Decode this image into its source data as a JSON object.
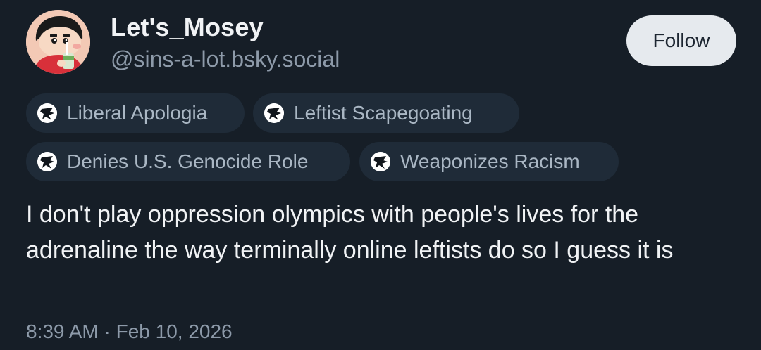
{
  "author": {
    "display_name": "Let's_Mosey",
    "handle": "@sins-a-lot.bsky.social",
    "avatar_icon": "cartoon-boy-avatar-icon"
  },
  "follow": {
    "label": "Follow"
  },
  "labels": [
    {
      "icon": "moderation-label-icon",
      "text": "Liberal Apologia"
    },
    {
      "icon": "moderation-label-icon",
      "text": "Leftist Scapegoating"
    },
    {
      "icon": "moderation-label-icon",
      "text": "Denies U.S. Genocide Role"
    },
    {
      "icon": "moderation-label-icon",
      "text": "Weaponizes Racism"
    }
  ],
  "post": {
    "text": "I don't play oppression olympics with people's lives for the adrenaline the way terminally online leftists do so I guess it is",
    "timestamp": "8:39 AM · Feb 10, 2026"
  },
  "colors": {
    "background": "#161e27",
    "pill_background": "#1f2b38",
    "follow_background": "#e6eaee",
    "muted_text": "#8d9aa9"
  }
}
